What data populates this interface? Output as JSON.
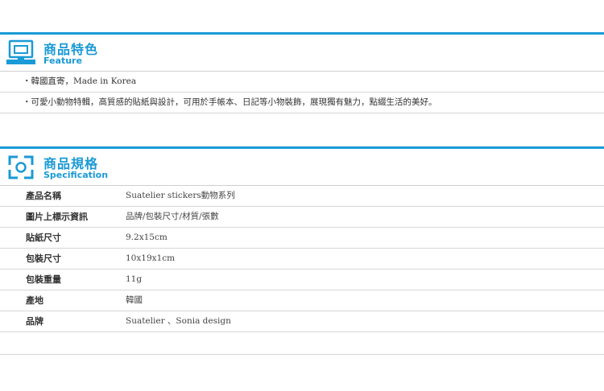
{
  "colors": {
    "accent": "#1a9ad6",
    "text": "#333333",
    "divider": "#d6d6d6"
  },
  "feature": {
    "title_zh": "商品特色",
    "title_en": "Feature",
    "icon": "monitor-icon",
    "items": [
      "・韓國直寄，Made in Korea",
      "・可愛小動物特輯，高質感的貼紙與設計，可用於手帳本、日記等小物裝飾，展現獨有魅力，點綴生活的美好。"
    ]
  },
  "spec": {
    "title_zh": "商品規格",
    "title_en": "Specification",
    "icon": "frame-icon",
    "rows": [
      {
        "label": "產品名稱",
        "value": "Suatelier stickers動物系列"
      },
      {
        "label": "圖片上標示資訊",
        "value": "品牌/包裝尺寸/材質/張數"
      },
      {
        "label": "貼紙尺寸",
        "value": "9.2x15cm"
      },
      {
        "label": "包裝尺寸",
        "value": "10x19x1cm"
      },
      {
        "label": "包裝重量",
        "value": "11g"
      },
      {
        "label": "產地",
        "value": "韓國"
      },
      {
        "label": "品牌",
        "value": "Suatelier 、Sonia design"
      }
    ]
  }
}
